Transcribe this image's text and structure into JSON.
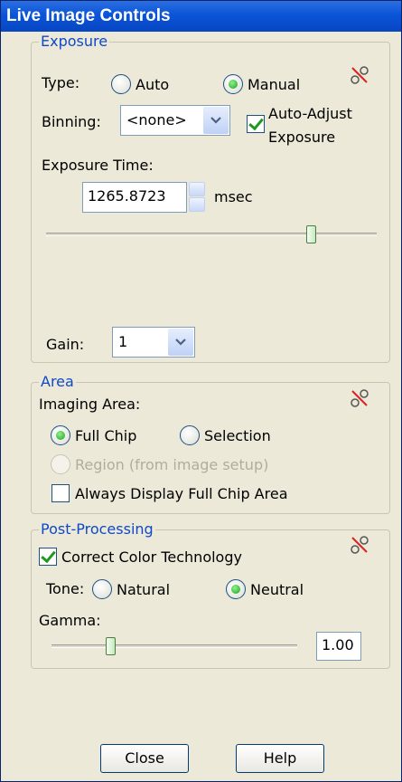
{
  "window": {
    "title": "Live Image Controls"
  },
  "exposure": {
    "legend": "Exposure",
    "type_label": "Type:",
    "type_options": [
      "Auto",
      "Manual"
    ],
    "type_selected": "Manual",
    "binning_label": "Binning:",
    "binning_value": "<none>",
    "auto_adjust_label_line1": "Auto-Adjust",
    "auto_adjust_label_line2": "Exposure",
    "auto_adjust_checked": true,
    "time_label": "Exposure Time:",
    "time_value": "1265.8723",
    "time_unit": "msec",
    "slider_level_fraction": 0.8,
    "gain_label": "Gain:",
    "gain_value": "1",
    "link_icon": "link-broken-icon"
  },
  "area": {
    "legend": "Area",
    "imaging_area_label": "Imaging Area:",
    "options": [
      "Full Chip",
      "Selection"
    ],
    "selected": "Full Chip",
    "region_label": "Region (from image setup)",
    "region_enabled": false,
    "always_display_label": "Always Display Full Chip Area",
    "always_display_checked": false,
    "link_icon": "link-broken-icon"
  },
  "post": {
    "legend": "Post-Processing",
    "cct_label": "Correct Color Technology",
    "cct_checked": true,
    "tone_label": "Tone:",
    "tone_options": [
      "Natural",
      "Neutral"
    ],
    "tone_selected": "Neutral",
    "gamma_label": "Gamma:",
    "gamma_value": "1.00",
    "gamma_slider_fraction": 0.24,
    "link_icon": "link-broken-icon"
  },
  "buttons": {
    "close": "Close",
    "help": "Help"
  },
  "colors": {
    "title_bar": "#0a54d8",
    "legend_text": "#0f49c9",
    "dialog_bg": "#ece9d8"
  }
}
